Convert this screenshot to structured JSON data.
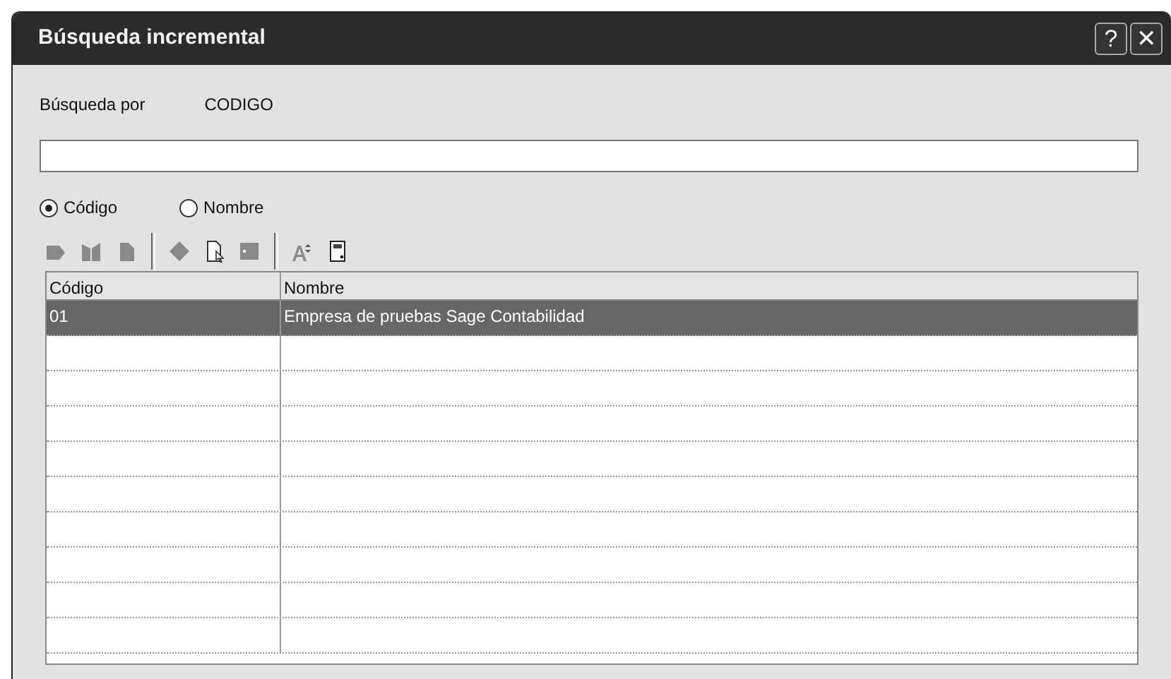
{
  "window": {
    "title": "Búsqueda incremental",
    "help_button": "?",
    "close_button": "✕"
  },
  "search_by": {
    "label": "Búsqueda por",
    "value": "CODIGO"
  },
  "radios": [
    {
      "label": "Código",
      "selected": true
    },
    {
      "label": "Nombre",
      "selected": false
    }
  ],
  "table": {
    "columns": [
      "Código",
      "Nombre"
    ],
    "rows": [
      {
        "cells": [
          "01",
          "Empresa de pruebas Sage Contabilidad"
        ],
        "selected": true
      }
    ]
  }
}
